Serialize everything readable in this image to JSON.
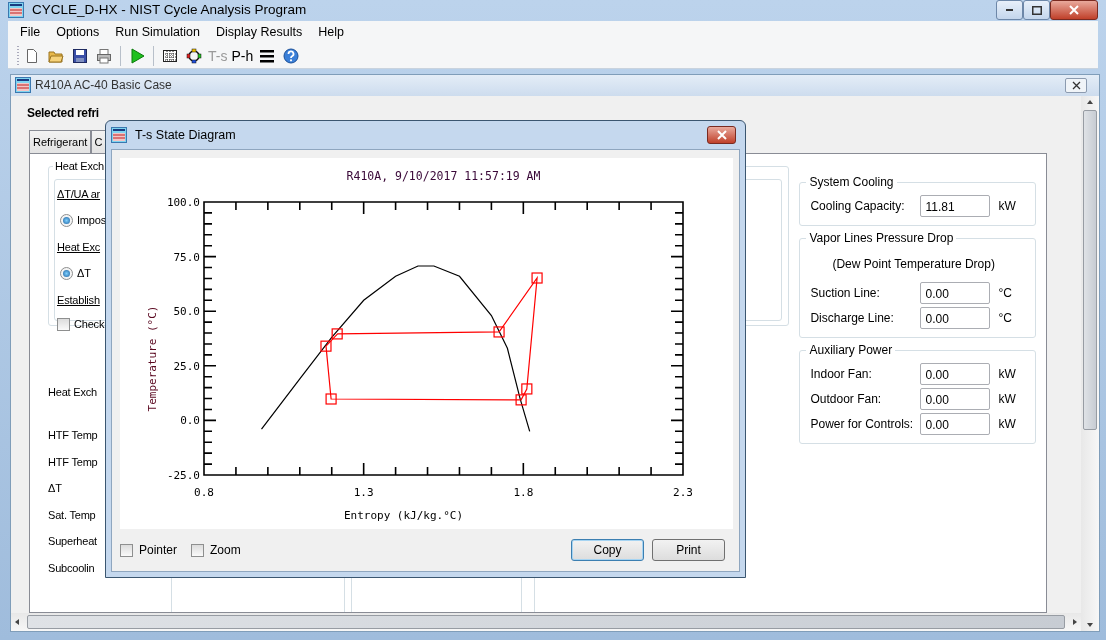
{
  "window": {
    "title": "CYCLE_D-HX - NIST Cycle Analysis Program"
  },
  "menu": [
    "File",
    "Options",
    "Run Simulation",
    "Display Results",
    "Help"
  ],
  "toolbar": [
    {
      "kind": "new",
      "disabled": false
    },
    {
      "kind": "open",
      "disabled": false
    },
    {
      "kind": "save",
      "disabled": false
    },
    {
      "kind": "print",
      "disabled": false
    },
    {
      "kind": "separator"
    },
    {
      "kind": "run",
      "disabled": false
    },
    {
      "kind": "separator"
    },
    {
      "kind": "table",
      "disabled": false
    },
    {
      "kind": "cycle",
      "disabled": false
    },
    {
      "kind": "text",
      "label": "T-s",
      "disabled": true
    },
    {
      "kind": "text",
      "label": "P-h",
      "disabled": false
    },
    {
      "kind": "lines",
      "disabled": false
    },
    {
      "kind": "help",
      "disabled": false
    }
  ],
  "document": {
    "title": "R410A AC-40 Basic Case",
    "selected_label": "Selected refri",
    "tabs": [
      {
        "label": "Refrigerant"
      },
      {
        "label": "C"
      }
    ],
    "options_group": {
      "title": "Heat Exch",
      "rows": [
        {
          "kind": "heading",
          "label": "ΔT/UA ar"
        },
        {
          "kind": "radio",
          "label": "Impos",
          "checked": true
        },
        {
          "kind": "heading",
          "label": "Heat Exc"
        },
        {
          "kind": "radio",
          "label": "ΔT",
          "checked": true
        },
        {
          "kind": "heading",
          "label": "Establish"
        },
        {
          "kind": "checkbox",
          "label": "Check",
          "checked": false
        }
      ]
    },
    "row_labels": [
      "Heat Exch",
      "HTF Temp",
      "HTF Temp",
      "ΔT",
      "Sat. Temp",
      "Superheat",
      "Subcoolin"
    ],
    "groups": [
      {
        "title": "System Cooling",
        "fields": [
          {
            "label": "Cooling Capacity:",
            "value": "11.81",
            "unit": "kW"
          }
        ]
      },
      {
        "title": "Vapor Lines Pressure Drop",
        "note": "(Dew Point Temperature Drop)",
        "fields": [
          {
            "label": "Suction Line:",
            "value": "0.00",
            "unit": "°C"
          },
          {
            "label": "Discharge Line:",
            "value": "0.00",
            "unit": "°C"
          }
        ]
      },
      {
        "title": "Auxiliary Power",
        "fields": [
          {
            "label": "Indoor Fan:",
            "value": "0.00",
            "unit": "kW"
          },
          {
            "label": "Outdoor Fan:",
            "value": "0.00",
            "unit": "kW"
          },
          {
            "label": "Power for Controls:",
            "value": "0.00",
            "unit": "kW"
          }
        ]
      }
    ]
  },
  "dialog": {
    "title": "T-s State Diagram",
    "chart_data": {
      "type": "line",
      "title": "R410A, 9/10/2017 11:57:19 AM",
      "xlabel": "Entropy (kJ/kg.°C)",
      "ylabel": "Temperature (°C)",
      "xlim": [
        0.8,
        2.3
      ],
      "ylim": [
        -25,
        100
      ],
      "x": [
        0.98,
        1.1,
        1.2,
        1.3,
        1.4,
        1.47,
        1.52,
        1.6,
        1.7,
        1.75,
        1.79,
        1.82,
        1.217,
        1.724,
        1.843,
        1.811,
        1.793,
        1.198,
        1.182,
        1.219
      ],
      "xticks": [
        {
          "value": 0.8,
          "label": "0.8"
        },
        {
          "value": 1.3,
          "label": "1.3"
        },
        {
          "value": 1.8,
          "label": "1.8"
        },
        {
          "value": 2.3,
          "label": "2.3"
        }
      ],
      "yticks": [
        {
          "value": -25,
          "label": "-25.0"
        },
        {
          "value": 0,
          "label": "0.0"
        },
        {
          "value": 25,
          "label": "25.0"
        },
        {
          "value": 50,
          "label": "50.0"
        },
        {
          "value": 75,
          "label": "75.0"
        },
        {
          "value": 100,
          "label": "100.0"
        }
      ],
      "series": [
        {
          "color": "#000000",
          "marker": "none",
          "values": [
            -4,
            19,
            38,
            55,
            66,
            70.7,
            70.7,
            66,
            48,
            33,
            10,
            -5,
            null,
            null,
            null,
            null,
            null,
            null,
            null,
            null
          ]
        },
        {
          "color": "#ff0000",
          "marker": "square",
          "values": [
            null,
            null,
            null,
            null,
            null,
            null,
            null,
            null,
            null,
            null,
            null,
            null,
            39.6,
            40.5,
            65.2,
            14.4,
            9.4,
            9.8,
            34.0,
            39.7
          ]
        }
      ]
    },
    "options": [
      {
        "label": "Pointer",
        "checked": false
      },
      {
        "label": "Zoom",
        "checked": false
      }
    ],
    "buttons": [
      {
        "label": "Copy",
        "default": true
      },
      {
        "label": "Print",
        "default": false
      }
    ]
  }
}
